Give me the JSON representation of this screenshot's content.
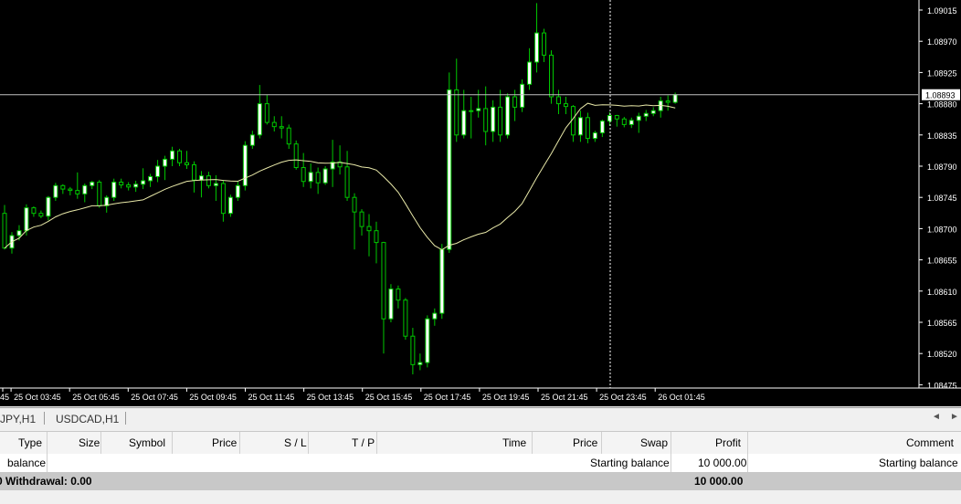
{
  "chart": {
    "symbol": "USDCAD",
    "timeframe": "H1",
    "colors": {
      "background": "#000000",
      "bull": "#00c800",
      "bull_fill": "#ffffff",
      "bear": "#00c800",
      "bear_fill": "#00c800",
      "ma": "#e8e8a8",
      "axis_text": "#ffffff",
      "price_line": "#bfbfbf",
      "crosshair": "#ffffff"
    },
    "price_axis": {
      "ticks": [
        "1.09015",
        "1.08970",
        "1.08925",
        "1.08880",
        "1.08835",
        "1.08790",
        "1.08745",
        "1.08700",
        "1.08655",
        "1.08610",
        "1.08565",
        "1.08520",
        "1.08475"
      ],
      "current_price": "1.08893"
    },
    "time_axis": {
      "ticks": [
        "45",
        "25 Oct 03:45",
        "25 Oct 05:45",
        "25 Oct 07:45",
        "25 Oct 09:45",
        "25 Oct 11:45",
        "25 Oct 13:45",
        "25 Oct 15:45",
        "25 Oct 17:45",
        "25 Oct 19:45",
        "25 Oct 21:45",
        "25 Oct 23:45",
        "26 Oct 01:45"
      ]
    }
  },
  "tabs": {
    "items": [
      "JPY,H1",
      "USDCAD,H1"
    ],
    "scroll_left": "◄",
    "scroll_right": "►"
  },
  "table": {
    "headers": {
      "prefix": "",
      "type": "Type",
      "size": "Size",
      "symbol": "Symbol",
      "price": "Price",
      "sl": "S / L",
      "tp": "T / P",
      "time": "Time",
      "price2": "Price",
      "swap": "Swap",
      "profit": "Profit",
      "comment": "Comment"
    },
    "rows": [
      {
        "type": "balance",
        "price2_text": "Starting balance",
        "profit": "10 000.00",
        "comment": "Starting balance"
      }
    ],
    "total": {
      "label": "0  Withdrawal: 0.00",
      "profit": "10 000.00"
    }
  }
}
